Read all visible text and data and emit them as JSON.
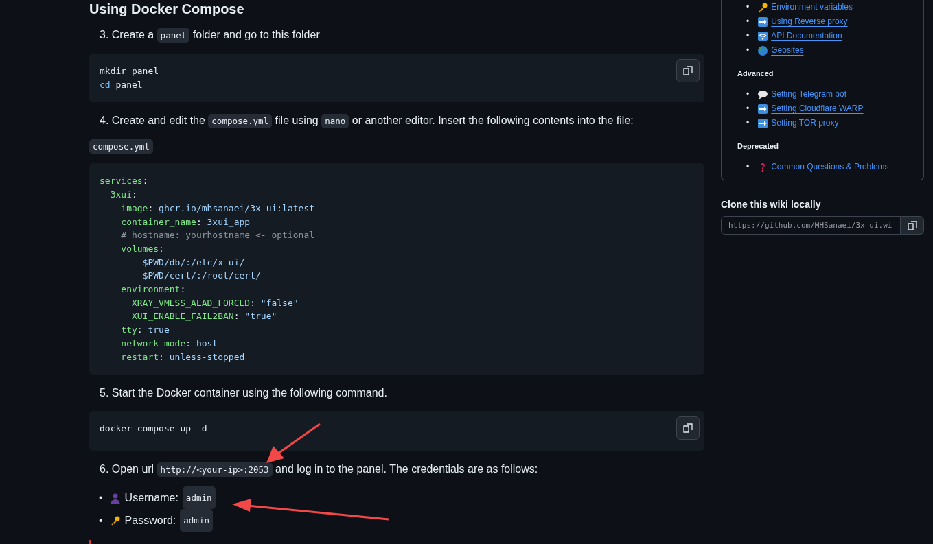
{
  "heading": "Using Docker Compose",
  "content": [
    {
      "kind": "para",
      "parts": [
        {
          "kind": "text",
          "text": "3. Create a "
        },
        {
          "kind": "code",
          "text": "panel"
        },
        {
          "kind": "text",
          "text": " folder and go to this folder"
        }
      ]
    },
    {
      "kind": "block",
      "copy_button": true,
      "lines": [
        [
          {
            "kind": "plain",
            "text": "mkdir panel"
          }
        ],
        [
          {
            "kind": "builtin",
            "text": "cd"
          },
          {
            "kind": "plain",
            "text": " panel"
          }
        ]
      ]
    },
    {
      "kind": "para",
      "parts": [
        {
          "kind": "text",
          "text": "4. Create and edit the "
        },
        {
          "kind": "code",
          "text": "compose.yml"
        },
        {
          "kind": "text",
          "text": " file using "
        },
        {
          "kind": "code",
          "text": "nano"
        },
        {
          "kind": "text",
          "text": " or another editor. Insert the following contents into the file:"
        }
      ]
    },
    {
      "kind": "label",
      "text": "compose.yml"
    },
    {
      "kind": "block",
      "copy_button": false,
      "lines": [
        [
          {
            "kind": "key",
            "text": "services"
          },
          {
            "kind": "plain",
            "text": ":"
          }
        ],
        [
          {
            "kind": "key",
            "text": "  3xui"
          },
          {
            "kind": "plain",
            "text": ":"
          }
        ],
        [
          {
            "kind": "key",
            "text": "    image"
          },
          {
            "kind": "plain",
            "text": ": "
          },
          {
            "kind": "value",
            "text": "ghcr.io/mhsanaei/3x-ui:latest"
          }
        ],
        [
          {
            "kind": "key",
            "text": "    container_name"
          },
          {
            "kind": "plain",
            "text": ": "
          },
          {
            "kind": "value",
            "text": "3xui_app"
          }
        ],
        [
          {
            "kind": "comment",
            "text": "    # hostname: yourhostname <- optional"
          }
        ],
        [
          {
            "kind": "key",
            "text": "    volumes"
          },
          {
            "kind": "plain",
            "text": ":"
          }
        ],
        [
          {
            "kind": "plain",
            "text": "      - "
          },
          {
            "kind": "value",
            "text": "$PWD/db/:/etc/x-ui/"
          }
        ],
        [
          {
            "kind": "plain",
            "text": "      - "
          },
          {
            "kind": "value",
            "text": "$PWD/cert/:/root/cert/"
          }
        ],
        [
          {
            "kind": "key",
            "text": "    environment"
          },
          {
            "kind": "plain",
            "text": ":"
          }
        ],
        [
          {
            "kind": "key",
            "text": "      XRAY_VMESS_AEAD_FORCED"
          },
          {
            "kind": "plain",
            "text": ": "
          },
          {
            "kind": "value",
            "text": "\"false\""
          }
        ],
        [
          {
            "kind": "key",
            "text": "      XUI_ENABLE_FAIL2BAN"
          },
          {
            "kind": "plain",
            "text": ": "
          },
          {
            "kind": "value",
            "text": "\"true\""
          }
        ],
        [
          {
            "kind": "key",
            "text": "    tty"
          },
          {
            "kind": "plain",
            "text": ": "
          },
          {
            "kind": "value",
            "text": "true"
          }
        ],
        [
          {
            "kind": "key",
            "text": "    network_mode"
          },
          {
            "kind": "plain",
            "text": ": "
          },
          {
            "kind": "value",
            "text": "host"
          }
        ],
        [
          {
            "kind": "key",
            "text": "    restart"
          },
          {
            "kind": "plain",
            "text": ": "
          },
          {
            "kind": "value",
            "text": "unless-stopped"
          }
        ]
      ]
    },
    {
      "kind": "para",
      "parts": [
        {
          "kind": "text",
          "text": "5. Start the Docker container using the following command."
        }
      ]
    },
    {
      "kind": "block",
      "copy_button": true,
      "lines": [
        [
          {
            "kind": "plain",
            "text": "docker compose up -d"
          }
        ]
      ]
    },
    {
      "kind": "para",
      "parts": [
        {
          "kind": "text",
          "text": "6. Open url "
        },
        {
          "kind": "code",
          "text": "http://<your-ip>:2053"
        },
        {
          "kind": "text",
          "text": " and log in to the panel. The credentials are as follows:"
        }
      ]
    },
    {
      "kind": "list",
      "items": [
        {
          "bullet": "•",
          "kind": "person",
          "label": "Username:",
          "code": "admin"
        },
        {
          "bullet": "•",
          "kind": "key",
          "label": "Password:",
          "code": "admin"
        }
      ]
    }
  ],
  "sidebar": {
    "sections": [
      {
        "items": [
          {
            "bullet": "•",
            "kind": "key",
            "text": "Environment variables"
          },
          {
            "bullet": "•",
            "kind": "arrow",
            "text": "Using Reverse proxy"
          },
          {
            "bullet": "•",
            "kind": "signal",
            "text": "API Documentation"
          },
          {
            "bullet": "•",
            "kind": "globe",
            "text": "Geosites"
          }
        ]
      },
      {
        "title": "Advanced",
        "items": [
          {
            "bullet": "•",
            "kind": "speech",
            "text": "Setting Telegram bot"
          },
          {
            "bullet": "•",
            "kind": "arrow",
            "text": "Setting Cloudflare WARP"
          },
          {
            "bullet": "•",
            "kind": "arrow",
            "text": "Setting TOR proxy"
          }
        ]
      },
      {
        "title": "Deprecated",
        "items": [
          {
            "bullet": "•",
            "kind": "question",
            "text": "Common Questions & Problems"
          }
        ]
      }
    ],
    "clone": {
      "title": "Clone this wiki locally",
      "url": "https://github.com/MHSanaei/3x-ui.wi"
    }
  }
}
